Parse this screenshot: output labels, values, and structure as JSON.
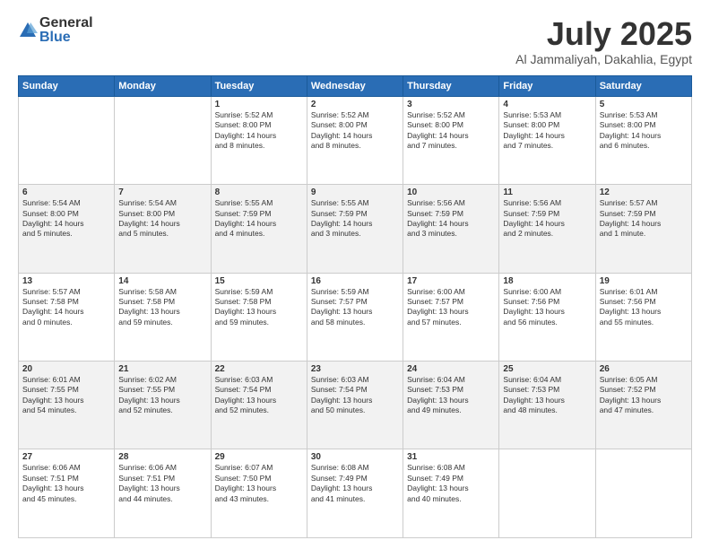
{
  "logo": {
    "general": "General",
    "blue": "Blue"
  },
  "title": "July 2025",
  "subtitle": "Al Jammaliyah, Dakahlia, Egypt",
  "days": [
    "Sunday",
    "Monday",
    "Tuesday",
    "Wednesday",
    "Thursday",
    "Friday",
    "Saturday"
  ],
  "weeks": [
    [
      {
        "day": "",
        "lines": []
      },
      {
        "day": "",
        "lines": []
      },
      {
        "day": "1",
        "lines": [
          "Sunrise: 5:52 AM",
          "Sunset: 8:00 PM",
          "Daylight: 14 hours",
          "and 8 minutes."
        ]
      },
      {
        "day": "2",
        "lines": [
          "Sunrise: 5:52 AM",
          "Sunset: 8:00 PM",
          "Daylight: 14 hours",
          "and 8 minutes."
        ]
      },
      {
        "day": "3",
        "lines": [
          "Sunrise: 5:52 AM",
          "Sunset: 8:00 PM",
          "Daylight: 14 hours",
          "and 7 minutes."
        ]
      },
      {
        "day": "4",
        "lines": [
          "Sunrise: 5:53 AM",
          "Sunset: 8:00 PM",
          "Daylight: 14 hours",
          "and 7 minutes."
        ]
      },
      {
        "day": "5",
        "lines": [
          "Sunrise: 5:53 AM",
          "Sunset: 8:00 PM",
          "Daylight: 14 hours",
          "and 6 minutes."
        ]
      }
    ],
    [
      {
        "day": "6",
        "lines": [
          "Sunrise: 5:54 AM",
          "Sunset: 8:00 PM",
          "Daylight: 14 hours",
          "and 5 minutes."
        ]
      },
      {
        "day": "7",
        "lines": [
          "Sunrise: 5:54 AM",
          "Sunset: 8:00 PM",
          "Daylight: 14 hours",
          "and 5 minutes."
        ]
      },
      {
        "day": "8",
        "lines": [
          "Sunrise: 5:55 AM",
          "Sunset: 7:59 PM",
          "Daylight: 14 hours",
          "and 4 minutes."
        ]
      },
      {
        "day": "9",
        "lines": [
          "Sunrise: 5:55 AM",
          "Sunset: 7:59 PM",
          "Daylight: 14 hours",
          "and 3 minutes."
        ]
      },
      {
        "day": "10",
        "lines": [
          "Sunrise: 5:56 AM",
          "Sunset: 7:59 PM",
          "Daylight: 14 hours",
          "and 3 minutes."
        ]
      },
      {
        "day": "11",
        "lines": [
          "Sunrise: 5:56 AM",
          "Sunset: 7:59 PM",
          "Daylight: 14 hours",
          "and 2 minutes."
        ]
      },
      {
        "day": "12",
        "lines": [
          "Sunrise: 5:57 AM",
          "Sunset: 7:59 PM",
          "Daylight: 14 hours",
          "and 1 minute."
        ]
      }
    ],
    [
      {
        "day": "13",
        "lines": [
          "Sunrise: 5:57 AM",
          "Sunset: 7:58 PM",
          "Daylight: 14 hours",
          "and 0 minutes."
        ]
      },
      {
        "day": "14",
        "lines": [
          "Sunrise: 5:58 AM",
          "Sunset: 7:58 PM",
          "Daylight: 13 hours",
          "and 59 minutes."
        ]
      },
      {
        "day": "15",
        "lines": [
          "Sunrise: 5:59 AM",
          "Sunset: 7:58 PM",
          "Daylight: 13 hours",
          "and 59 minutes."
        ]
      },
      {
        "day": "16",
        "lines": [
          "Sunrise: 5:59 AM",
          "Sunset: 7:57 PM",
          "Daylight: 13 hours",
          "and 58 minutes."
        ]
      },
      {
        "day": "17",
        "lines": [
          "Sunrise: 6:00 AM",
          "Sunset: 7:57 PM",
          "Daylight: 13 hours",
          "and 57 minutes."
        ]
      },
      {
        "day": "18",
        "lines": [
          "Sunrise: 6:00 AM",
          "Sunset: 7:56 PM",
          "Daylight: 13 hours",
          "and 56 minutes."
        ]
      },
      {
        "day": "19",
        "lines": [
          "Sunrise: 6:01 AM",
          "Sunset: 7:56 PM",
          "Daylight: 13 hours",
          "and 55 minutes."
        ]
      }
    ],
    [
      {
        "day": "20",
        "lines": [
          "Sunrise: 6:01 AM",
          "Sunset: 7:55 PM",
          "Daylight: 13 hours",
          "and 54 minutes."
        ]
      },
      {
        "day": "21",
        "lines": [
          "Sunrise: 6:02 AM",
          "Sunset: 7:55 PM",
          "Daylight: 13 hours",
          "and 52 minutes."
        ]
      },
      {
        "day": "22",
        "lines": [
          "Sunrise: 6:03 AM",
          "Sunset: 7:54 PM",
          "Daylight: 13 hours",
          "and 52 minutes."
        ]
      },
      {
        "day": "23",
        "lines": [
          "Sunrise: 6:03 AM",
          "Sunset: 7:54 PM",
          "Daylight: 13 hours",
          "and 50 minutes."
        ]
      },
      {
        "day": "24",
        "lines": [
          "Sunrise: 6:04 AM",
          "Sunset: 7:53 PM",
          "Daylight: 13 hours",
          "and 49 minutes."
        ]
      },
      {
        "day": "25",
        "lines": [
          "Sunrise: 6:04 AM",
          "Sunset: 7:53 PM",
          "Daylight: 13 hours",
          "and 48 minutes."
        ]
      },
      {
        "day": "26",
        "lines": [
          "Sunrise: 6:05 AM",
          "Sunset: 7:52 PM",
          "Daylight: 13 hours",
          "and 47 minutes."
        ]
      }
    ],
    [
      {
        "day": "27",
        "lines": [
          "Sunrise: 6:06 AM",
          "Sunset: 7:51 PM",
          "Daylight: 13 hours",
          "and 45 minutes."
        ]
      },
      {
        "day": "28",
        "lines": [
          "Sunrise: 6:06 AM",
          "Sunset: 7:51 PM",
          "Daylight: 13 hours",
          "and 44 minutes."
        ]
      },
      {
        "day": "29",
        "lines": [
          "Sunrise: 6:07 AM",
          "Sunset: 7:50 PM",
          "Daylight: 13 hours",
          "and 43 minutes."
        ]
      },
      {
        "day": "30",
        "lines": [
          "Sunrise: 6:08 AM",
          "Sunset: 7:49 PM",
          "Daylight: 13 hours",
          "and 41 minutes."
        ]
      },
      {
        "day": "31",
        "lines": [
          "Sunrise: 6:08 AM",
          "Sunset: 7:49 PM",
          "Daylight: 13 hours",
          "and 40 minutes."
        ]
      },
      {
        "day": "",
        "lines": []
      },
      {
        "day": "",
        "lines": []
      }
    ]
  ]
}
